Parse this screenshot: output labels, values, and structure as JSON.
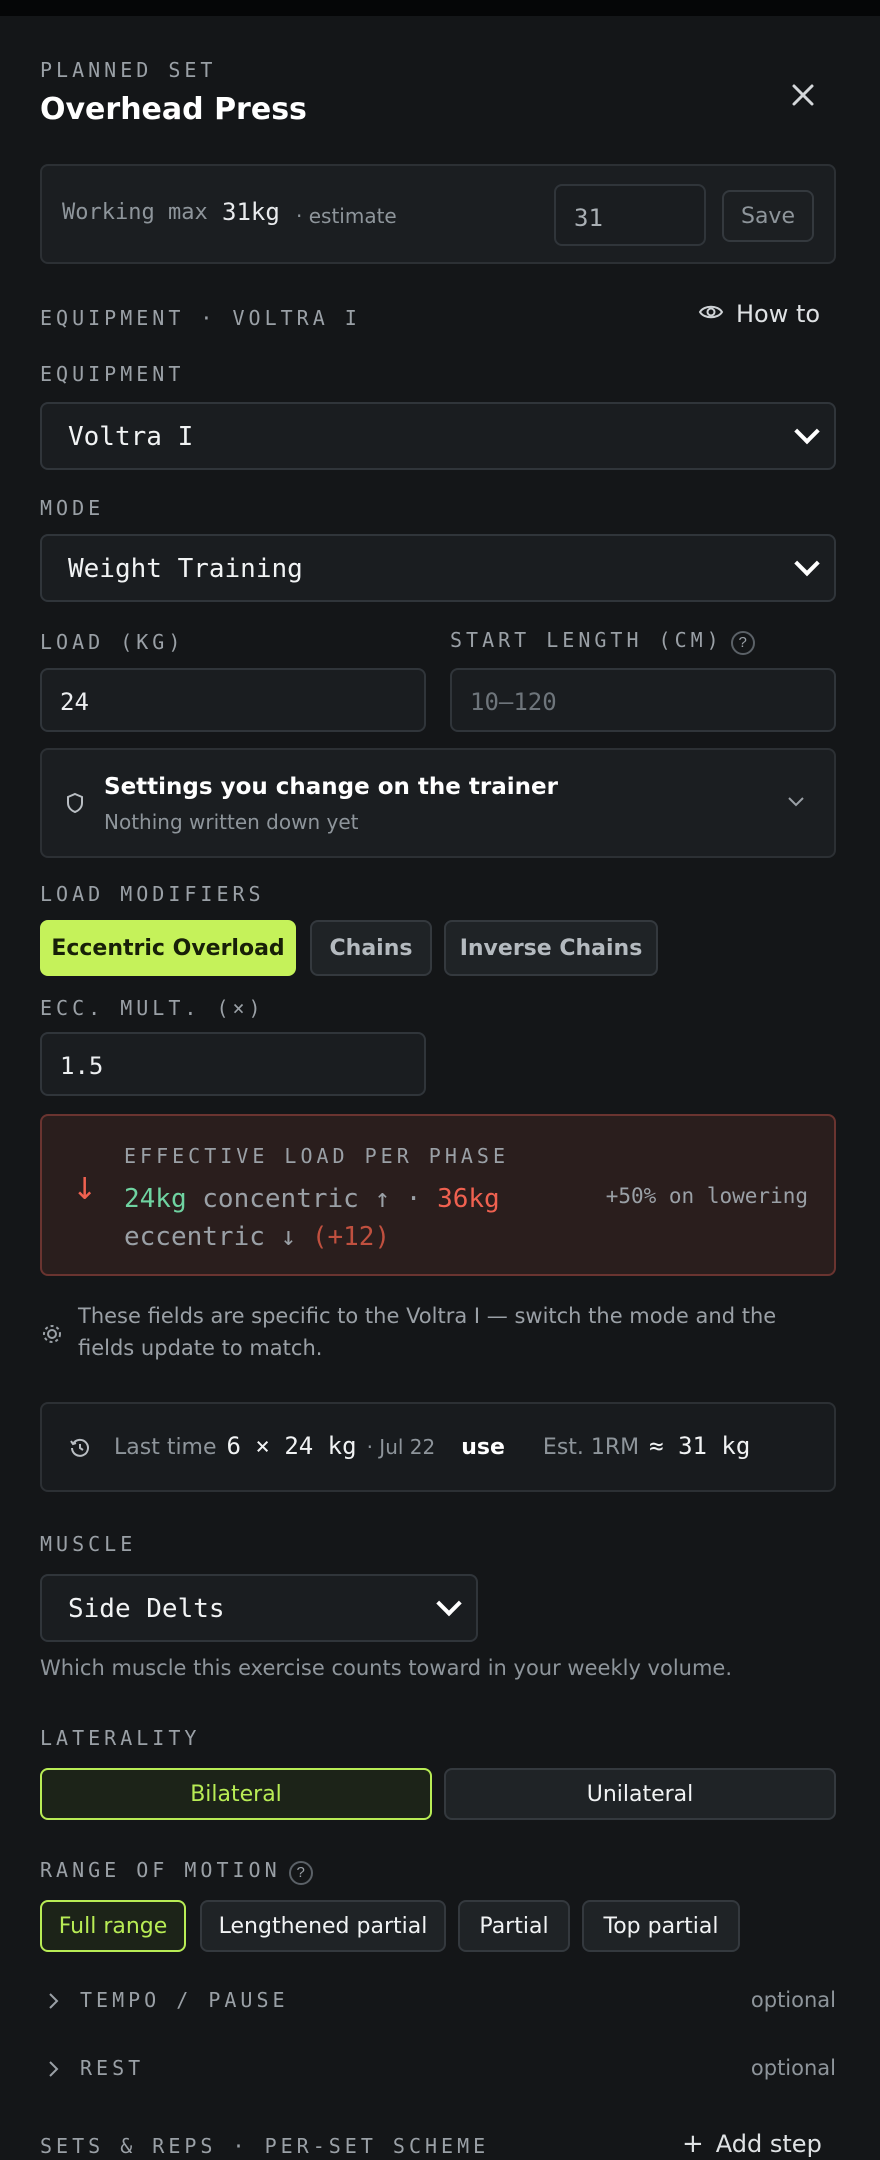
{
  "header": {
    "eyebrow": "PLANNED SET",
    "title": "Overhead Press"
  },
  "working_max": {
    "label": "Working max",
    "value": "31kg",
    "qualifier": "· estimate",
    "input_value": "31",
    "save_label": "Save"
  },
  "equipment_section": {
    "heading": "EQUIPMENT · VOLTRA I",
    "how_to_label": "How to",
    "equipment_label": "EQUIPMENT",
    "equipment_value": "Voltra I",
    "mode_label": "MODE",
    "mode_value": "Weight Training",
    "load_label": "LOAD (KG)",
    "load_value": "24",
    "start_length_label": "START LENGTH (CM)",
    "start_length_placeholder": "10–120",
    "help_glyph": "?"
  },
  "trainer_settings": {
    "title": "Settings you change on the trainer",
    "subtitle": "Nothing written down yet"
  },
  "load_modifiers": {
    "label": "LOAD MODIFIERS",
    "options": [
      "Eccentric Overload",
      "Chains",
      "Inverse Chains"
    ],
    "ecc_label": "ECC. MULT. (×)",
    "ecc_value": "1.5"
  },
  "effective_load": {
    "title": "EFFECTIVE LOAD PER PHASE",
    "concentric_value": "24kg",
    "concentric_text": "concentric ↑ ·",
    "eccentric_value": "36kg",
    "eccentric_text": "eccentric ↓",
    "delta": "(+12)",
    "note": "+50% on lowering",
    "arrow": "↓"
  },
  "info_note": "These fields are specific to the Voltra I — switch the mode and the fields update to match.",
  "last_time": {
    "label": "Last time",
    "value": "6 × 24 kg",
    "date": "· Jul 22",
    "use_label": "use",
    "est_label": "Est. 1RM",
    "est_value": "≈ 31 kg"
  },
  "muscle": {
    "label": "MUSCLE",
    "value": "Side Delts",
    "help": "Which muscle this exercise counts toward in your weekly volume."
  },
  "laterality": {
    "label": "LATERALITY",
    "options": [
      "Bilateral",
      "Unilateral"
    ]
  },
  "range_of_motion": {
    "label": "RANGE OF MOTION",
    "options": [
      "Full range",
      "Lengthened partial",
      "Partial",
      "Top partial"
    ]
  },
  "collapsibles": [
    {
      "label": "TEMPO / PAUSE",
      "hint": "optional"
    },
    {
      "label": "REST",
      "hint": "optional"
    }
  ],
  "sets_reps": {
    "label": "SETS & REPS · PER-SET SCHEME",
    "add_step_label": "Add step"
  },
  "colors": {
    "accent": "#c5f25a",
    "accent_text": "#b8ec55",
    "eccentric_red": "#ef6150",
    "concentric_green": "#6fd3a1",
    "panel_bg": "#141618"
  }
}
